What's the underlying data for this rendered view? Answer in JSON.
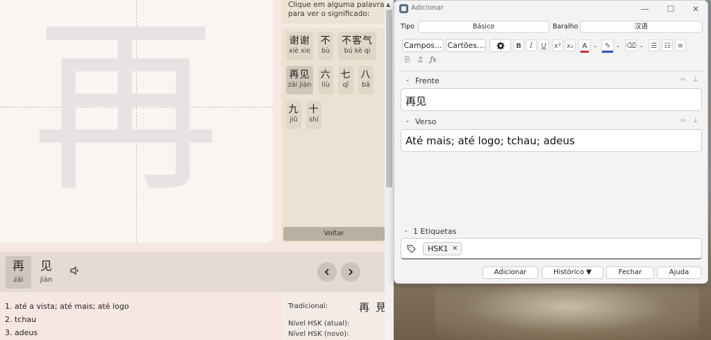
{
  "left_app": {
    "canvas_char": "再",
    "hint_text": "Clique em alguma palavra para ver o significado:",
    "word_buttons": [
      {
        "hanzi": "谢谢",
        "pinyin": "xiè xie"
      },
      {
        "hanzi": "不",
        "pinyin": "bù"
      },
      {
        "hanzi": "不客气",
        "pinyin": "bú kè qi"
      },
      {
        "hanzi": "再见",
        "pinyin": "zài jiàn"
      },
      {
        "hanzi": "六",
        "pinyin": "liù"
      },
      {
        "hanzi": "七",
        "pinyin": "qī"
      },
      {
        "hanzi": "八",
        "pinyin": "bā"
      },
      {
        "hanzi": "九",
        "pinyin": "jiǔ"
      },
      {
        "hanzi": "十",
        "pinyin": "shí"
      }
    ],
    "back_label": "Voltar",
    "chars": [
      {
        "hanzi": "再",
        "pinyin": "zài"
      },
      {
        "hanzi": "见",
        "pinyin": "jiàn"
      }
    ],
    "meanings": [
      "1. até a vista; até mais; até logo",
      "2. tchau",
      "3. adeus"
    ],
    "info": {
      "traditional_label": "Tradicional:",
      "traditional_value": "再見",
      "hsk_current_label": "Nível HSK (atual):",
      "hsk_new_label": "Nível HSK (novo):"
    }
  },
  "dialog": {
    "title": "Adicionar",
    "type_label": "Tipo",
    "type_value": "Básico",
    "deck_label": "Baralho",
    "deck_value": "汉语",
    "fields_button": "Campos...",
    "cards_button": "Cartões...",
    "front_label": "Frente",
    "front_value": "再见",
    "back_label": "Verso",
    "back_value": "Até mais; até logo; tchau; adeus",
    "tags_header": "1 Etiquetas",
    "tag": "HSK1",
    "buttons": {
      "add": "Adicionar",
      "history": "Histórico ▼",
      "close": "Fechar",
      "help": "Ajuda"
    }
  },
  "colors": {
    "left_bg": "#f6e7e2",
    "word_panel_bg": "#ece2d3",
    "dialog_bg": "#f3f3f3",
    "text_color_red": "#d02a2a",
    "highlight_blue": "#2a4fd0"
  }
}
